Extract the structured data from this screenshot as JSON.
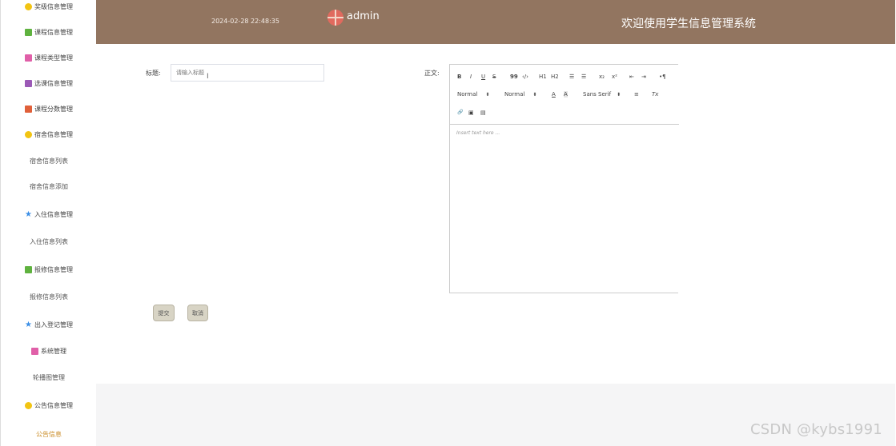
{
  "sidebar": {
    "items": [
      {
        "label": "奖级信息管理",
        "icon": "flower-icon",
        "color": "#f2c412"
      },
      {
        "label": "课程信息管理",
        "icon": "chat-icon",
        "color": "#5fb23f"
      },
      {
        "label": "课程类型管理",
        "icon": "doc-icon",
        "color": "#e05fa8"
      },
      {
        "label": "选课信息管理",
        "icon": "stack-icon",
        "color": "#9b59b6"
      },
      {
        "label": "课程分数管理",
        "icon": "grid-icon",
        "color": "#e0603a"
      },
      {
        "label": "宿舍信息管理",
        "icon": "flower-icon",
        "color": "#f2c412"
      },
      {
        "label": "宿舍信息列表",
        "icon": ""
      },
      {
        "label": "宿舍信息添加",
        "icon": ""
      },
      {
        "label": "入住信息管理",
        "icon": "star-icon",
        "color": "#3a8ee6"
      },
      {
        "label": "入住信息列表",
        "icon": ""
      },
      {
        "label": "报修信息管理",
        "icon": "chat-icon",
        "color": "#5fb23f"
      },
      {
        "label": "报修信息列表",
        "icon": ""
      },
      {
        "label": "出入登记管理",
        "icon": "star-icon",
        "color": "#3a8ee6"
      },
      {
        "label": "系统管理",
        "icon": "doc-icon",
        "color": "#e05fa8"
      },
      {
        "label": "轮播图管理",
        "icon": ""
      },
      {
        "label": "公告信息管理",
        "icon": "flower-icon",
        "color": "#f2c412"
      },
      {
        "label": "公告信息",
        "icon": "",
        "active": true
      }
    ]
  },
  "header": {
    "datetime": "2024-02-28 22:48:35",
    "user": "admin",
    "title": "欢迎使用学生信息管理系统",
    "bg_color": "#927560"
  },
  "form": {
    "title_label": "标题:",
    "title_placeholder": "请输入标题",
    "body_label": "正文:",
    "editor_placeholder": "Insert text here ...",
    "submit_label": "提交",
    "cancel_label": "取消"
  },
  "toolbar": {
    "bold": "B",
    "italic": "I",
    "underline": "U",
    "strike": "S",
    "blockquote": "99",
    "code": "‹/›",
    "h1": "H1",
    "h2": "H2",
    "ordered_list": "☰",
    "bullet_list": "☰",
    "subscript": "x₂",
    "superscript": "x²",
    "indent_left": "⇤",
    "indent_right": "⇥",
    "direction": "•¶",
    "size_select": "Normal",
    "header_select": "Normal",
    "font_color": "A",
    "background": "A",
    "font_select": "Sans Serif",
    "align": "≡",
    "clean": "Tx",
    "link": "🔗",
    "image": "▣",
    "video": "▤"
  },
  "watermark": "CSDN @kybs1991"
}
